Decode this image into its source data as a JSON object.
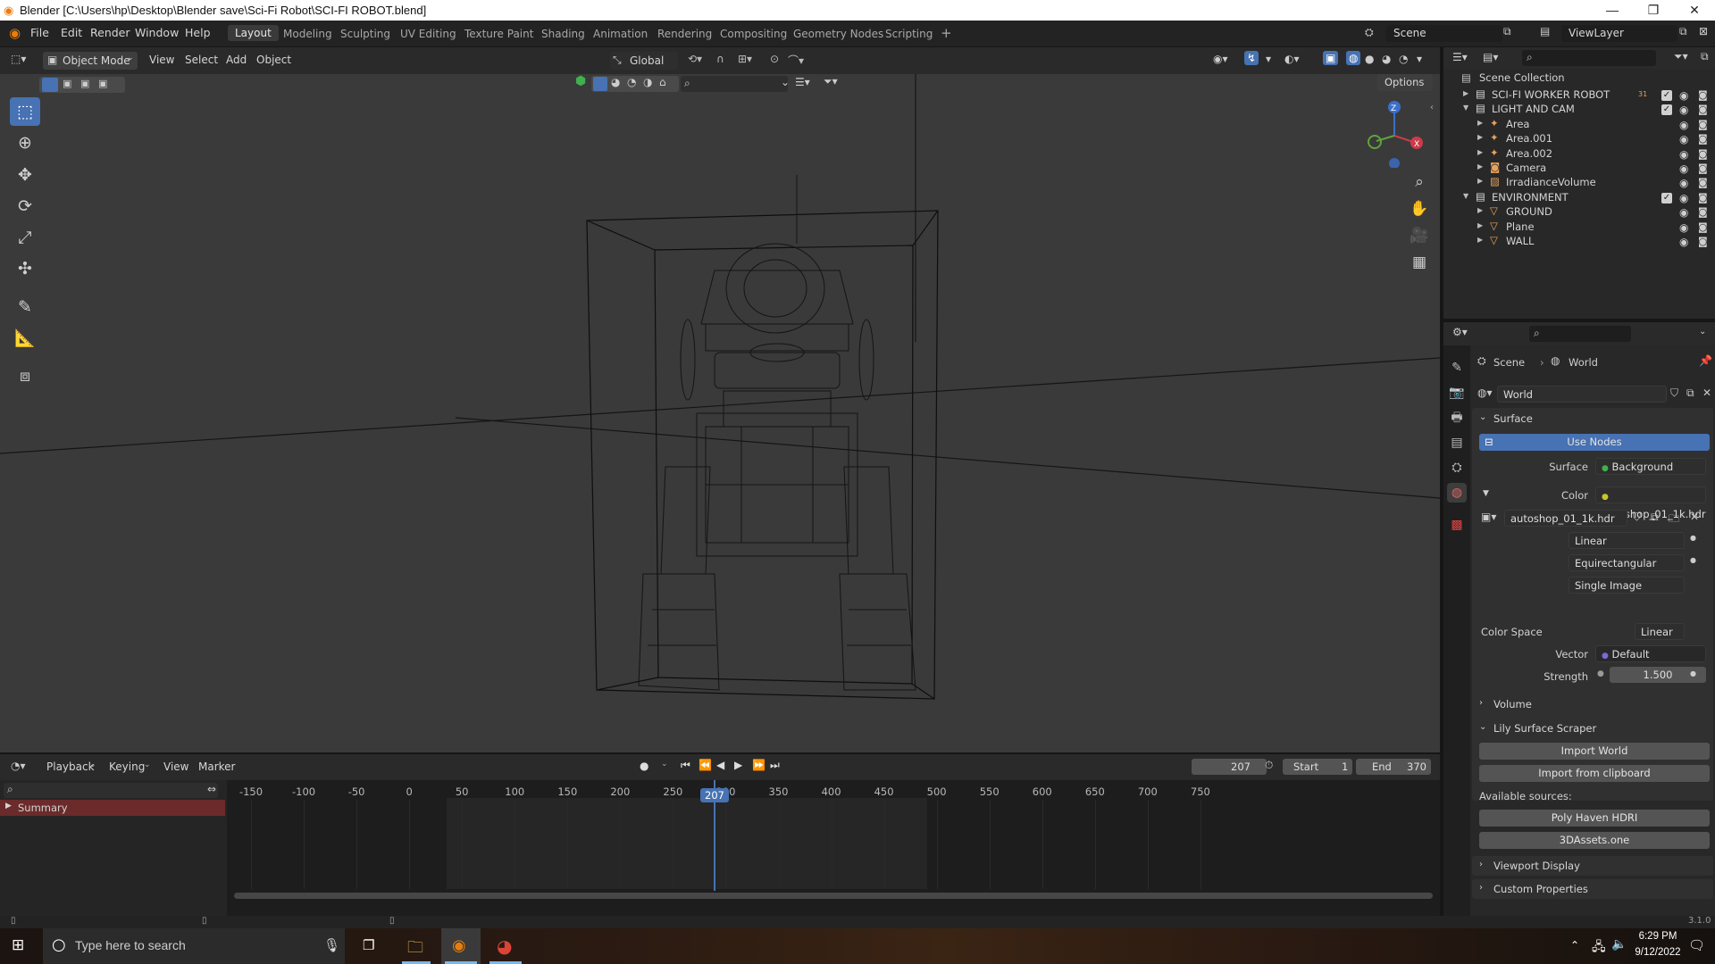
{
  "window": {
    "title": "Blender [C:\\Users\\hp\\Desktop\\Blender save\\Sci-Fi Robot\\SCI-FI ROBOT.blend]",
    "minimize": "—",
    "maximize": "❐",
    "close": "✕"
  },
  "menu": [
    "File",
    "Edit",
    "Render",
    "Window",
    "Help"
  ],
  "workspaces": [
    "Layout",
    "Modeling",
    "Sculpting",
    "UV Editing",
    "Texture Paint",
    "Shading",
    "Animation",
    "Rendering",
    "Compositing",
    "Geometry Nodes",
    "Scripting",
    "+"
  ],
  "scene": {
    "name": "Scene",
    "view_layer": "ViewLayer"
  },
  "viewport_header": {
    "mode": "Object Mode",
    "menus": [
      "View",
      "Select",
      "Add",
      "Object"
    ],
    "orientation": "Global",
    "options": "Options"
  },
  "timeline": {
    "menus": [
      "Playback",
      "Keying",
      "View",
      "Marker"
    ],
    "current_frame": "207",
    "start_label": "Start",
    "start": "1",
    "end_label": "End",
    "end": "370",
    "ticks": [
      "-150",
      "-100",
      "-50",
      "0",
      "50",
      "100",
      "150",
      "200",
      "250",
      "300",
      "350",
      "400",
      "450",
      "500",
      "550",
      "600",
      "650",
      "700",
      "750"
    ],
    "summary": "Summary"
  },
  "outliner": {
    "root": "Scene Collection",
    "rows": [
      {
        "label": "SCI-FI WORKER ROBOT",
        "indent": 0,
        "type": "collection",
        "badge": "31"
      },
      {
        "label": "LIGHT AND CAM",
        "indent": 0,
        "type": "collection",
        "badge": ""
      },
      {
        "label": "Area",
        "indent": 1,
        "type": "light",
        "badge": ""
      },
      {
        "label": "Area.001",
        "indent": 1,
        "type": "light",
        "badge": ""
      },
      {
        "label": "Area.002",
        "indent": 1,
        "type": "light",
        "badge": ""
      },
      {
        "label": "Camera",
        "indent": 1,
        "type": "camera",
        "badge": ""
      },
      {
        "label": "IrradianceVolume",
        "indent": 1,
        "type": "probe",
        "badge": ""
      },
      {
        "label": "ENVIRONMENT",
        "indent": 0,
        "type": "collection",
        "badge": ""
      },
      {
        "label": "GROUND",
        "indent": 1,
        "type": "mesh",
        "badge": ""
      },
      {
        "label": "Plane",
        "indent": 1,
        "type": "mesh",
        "badge": ""
      },
      {
        "label": "WALL",
        "indent": 1,
        "type": "mesh",
        "badge": ""
      }
    ]
  },
  "properties": {
    "breadcrumb": [
      "Scene",
      "World"
    ],
    "world_name": "World",
    "surface_panel": "Surface",
    "use_nodes": "Use Nodes",
    "surface_label": "Surface",
    "surface_value": "Background",
    "color_label": "Color",
    "color_value": "autoshop_01_1k.hdr",
    "image_name": "autoshop_01_1k.hdr",
    "interp": "Linear",
    "projection": "Equirectangular",
    "source": "Single Image",
    "colorspace_label": "Color Space",
    "colorspace_value": "Linear",
    "vector_label": "Vector",
    "vector_value": "Default",
    "strength_label": "Strength",
    "strength_value": "1.500",
    "volume_panel": "Volume",
    "lily_panel": "Lily Surface Scraper",
    "import_world": "Import World",
    "import_clipboard": "Import from clipboard",
    "available_sources": "Available sources:",
    "source1": "Poly Haven HDRI",
    "source2": "3DAssets.one",
    "viewport_display": "Viewport Display",
    "custom_props": "Custom Properties"
  },
  "version": "3.1.0",
  "taskbar": {
    "search_placeholder": "Type here to search",
    "time": "6:29 PM",
    "date": "9/12/2022"
  },
  "colors": {
    "accent": "#4772b3",
    "header": "#2a2a2a",
    "viewport": "#3a3a3a"
  }
}
